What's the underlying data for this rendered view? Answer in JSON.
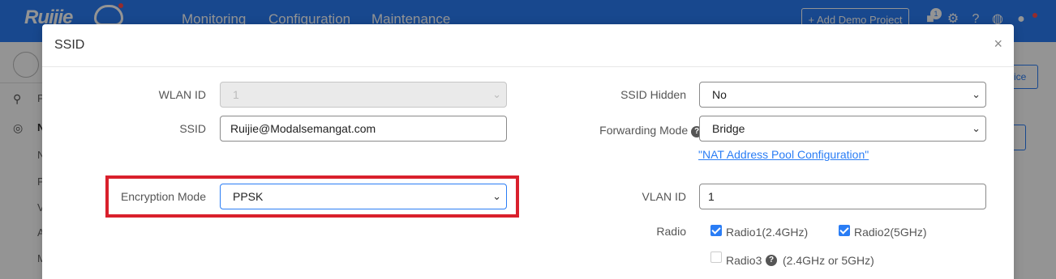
{
  "topnav": {
    "logo": "Ruijie",
    "items": [
      "Monitoring",
      "Configuration",
      "Maintenance"
    ],
    "demo_button": "+ Add Demo Project",
    "notification_count": "1"
  },
  "background": {
    "side_letters": [
      "P",
      "N",
      "N",
      "P",
      "V",
      "A",
      "M"
    ],
    "right_button_text": "ice"
  },
  "modal": {
    "title": "SSID",
    "close": "×",
    "wlan_id": {
      "label": "WLAN ID",
      "value": "1"
    },
    "ssid": {
      "label": "SSID",
      "value": "Ruijie@Modalsemangat.com"
    },
    "encryption_mode": {
      "label": "Encryption Mode",
      "value": "PPSK"
    },
    "ssid_hidden": {
      "label": "SSID Hidden",
      "value": "No"
    },
    "forwarding_mode": {
      "label": "Forwarding Mode",
      "value": "Bridge",
      "link": "\"NAT Address Pool Configuration\""
    },
    "vlan_id": {
      "label": "VLAN ID",
      "value": "1"
    },
    "radio": {
      "label": "Radio",
      "options": [
        {
          "label": "Radio1(2.4GHz)",
          "checked": true
        },
        {
          "label": "Radio2(5GHz)",
          "checked": true
        },
        {
          "label": "Radio3",
          "checked": false,
          "note": "(2.4GHz or 5GHz)"
        }
      ]
    }
  },
  "colors": {
    "brand": "#2a7df5",
    "highlight": "#d9202c"
  },
  "icons": [
    "user-icon",
    "topology-icon",
    "globe-icon",
    "chevron-down-icon",
    "help-icon",
    "close-icon",
    "gear-icon",
    "question-icon",
    "notification-icon"
  ]
}
